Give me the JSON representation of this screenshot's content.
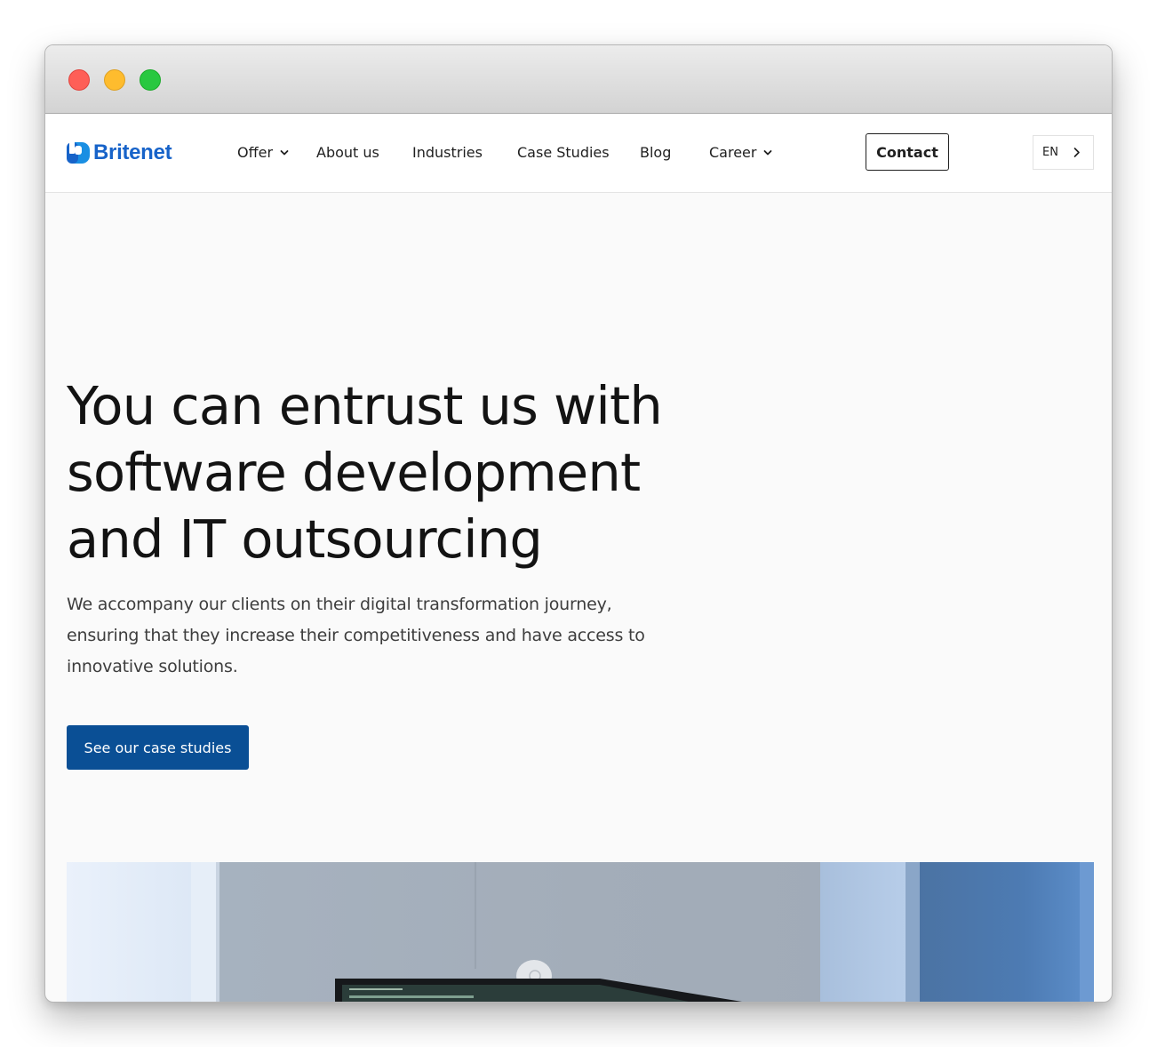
{
  "brand": {
    "name": "Britenet",
    "color": "#1763c9"
  },
  "nav": {
    "items": [
      {
        "label": "Offer",
        "has_dropdown": true
      },
      {
        "label": "About us",
        "has_dropdown": false
      },
      {
        "label": "Industries",
        "has_dropdown": false
      },
      {
        "label": "Case Studies",
        "has_dropdown": false
      },
      {
        "label": "Blog",
        "has_dropdown": false
      },
      {
        "label": "Career",
        "has_dropdown": true
      }
    ],
    "contact_label": "Contact",
    "language": "EN"
  },
  "hero": {
    "title": "You can entrust us with software development and IT outsourcing",
    "subtitle": "We accompany our clients on their digital transformation journey, ensuring that they increase their competitiveness and have access to innovative solutions.",
    "cta_label": "See our case studies",
    "cta_color": "#0a4f95"
  },
  "icons": {
    "dropdown": "chevron-down-icon",
    "language_next": "chevron-right-icon"
  }
}
